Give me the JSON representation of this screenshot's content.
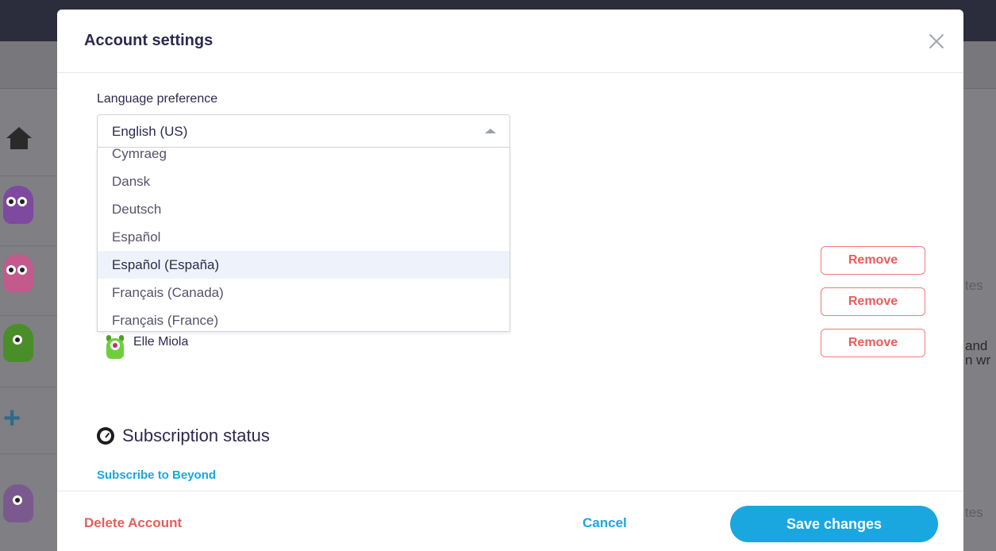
{
  "modal": {
    "title": "Account settings"
  },
  "language": {
    "label": "Language preference",
    "selected": "English (US)",
    "options": [
      "Cymraeg",
      "Dansk",
      "Deutsch",
      "Español",
      "Español (España)",
      "Français (Canada)",
      "Français (France)"
    ],
    "highlighted_index": 4
  },
  "students": {
    "remove_label": "Remove",
    "visible_name": "Elle Miola"
  },
  "subscription": {
    "title": "Subscription status",
    "link": "Subscribe to Beyond"
  },
  "footer": {
    "delete_label": "Delete Account",
    "cancel_label": "Cancel",
    "save_label": "Save changes"
  },
  "background": {
    "right_texts": [
      "tes",
      "and",
      "n wr",
      "tes"
    ]
  },
  "colors": {
    "accent": "#1aa7e0",
    "danger": "#ee5a5a",
    "title": "#2c2a50",
    "overlay": "#7b7b80"
  }
}
